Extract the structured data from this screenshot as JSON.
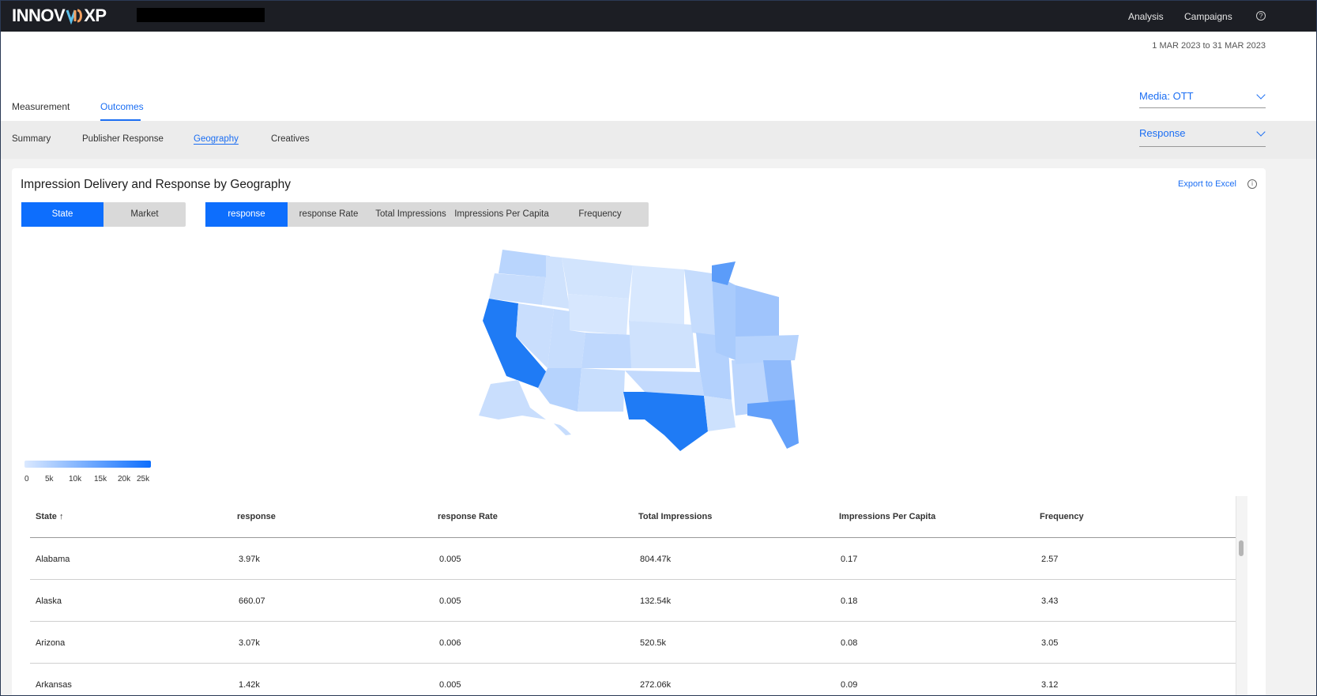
{
  "app": {
    "logo_text_left": "INNOV",
    "logo_text_right": "XP",
    "nav": [
      "Analysis",
      "Campaigns"
    ]
  },
  "date_range": "1 MAR 2023 to 31 MAR 2023",
  "tabs": [
    "Measurement",
    "Outcomes"
  ],
  "media_dropdown": "Media:  OTT",
  "metric_dropdown": "Response",
  "subtabs": [
    "Summary",
    "Publisher Response",
    "Geography",
    "Creatives"
  ],
  "card": {
    "title": "Impression Delivery and Response by Geography",
    "export_label": "Export to Excel"
  },
  "geo_toggle": [
    "State",
    "Market"
  ],
  "metric_toggle": [
    "response",
    "response Rate",
    "Total Impressions",
    "Impressions Per Capita",
    "Frequency"
  ],
  "legend": {
    "ticks": [
      "0",
      "5k",
      "10k",
      "15k",
      "20k",
      "25k"
    ],
    "color_low": "#dbe9ff",
    "color_high": "#0d6efd"
  },
  "table": {
    "columns": [
      "State ↑",
      "response",
      "response Rate",
      "Total Impressions",
      "Impressions Per Capita",
      "Frequency"
    ],
    "rows": [
      [
        "Alabama",
        "3.97k",
        "0.005",
        "804.47k",
        "0.17",
        "2.57"
      ],
      [
        "Alaska",
        "660.07",
        "0.005",
        "132.54k",
        "0.18",
        "3.43"
      ],
      [
        "Arizona",
        "3.07k",
        "0.006",
        "520.5k",
        "0.08",
        "3.05"
      ],
      [
        "Arkansas",
        "1.42k",
        "0.005",
        "272.06k",
        "0.09",
        "3.12"
      ]
    ]
  },
  "colors": {
    "accent": "#1b6ef3",
    "topbar": "#1c1e24"
  }
}
